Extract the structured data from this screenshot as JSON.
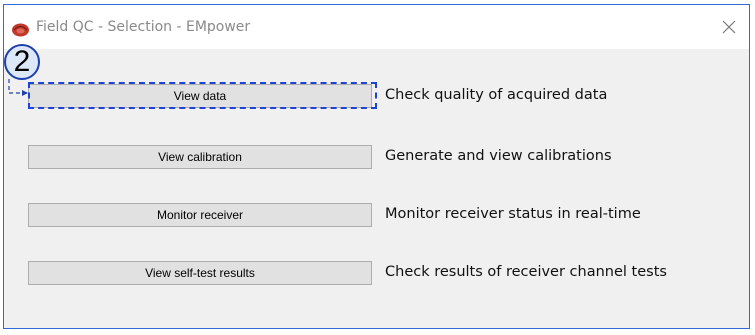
{
  "window": {
    "title": "Field QC - Selection - EMpower"
  },
  "step": {
    "number": "2"
  },
  "actions": [
    {
      "button_label": "View data",
      "description": "Check quality of acquired data"
    },
    {
      "button_label": "View calibration",
      "description": "Generate and view calibrations"
    },
    {
      "button_label": "Monitor receiver",
      "description": "Monitor receiver status in real-time"
    },
    {
      "button_label": "View self-test results",
      "description": "Check results of receiver channel tests"
    }
  ],
  "icons": {
    "app": "app-logo-icon",
    "close": "close-icon"
  },
  "colors": {
    "window_border": "#2f6bd8",
    "focus_outline": "#1d44d6",
    "callout_fill": "#dce8f8",
    "callout_border": "#1f3fae",
    "app_icon": "#c0392b"
  }
}
